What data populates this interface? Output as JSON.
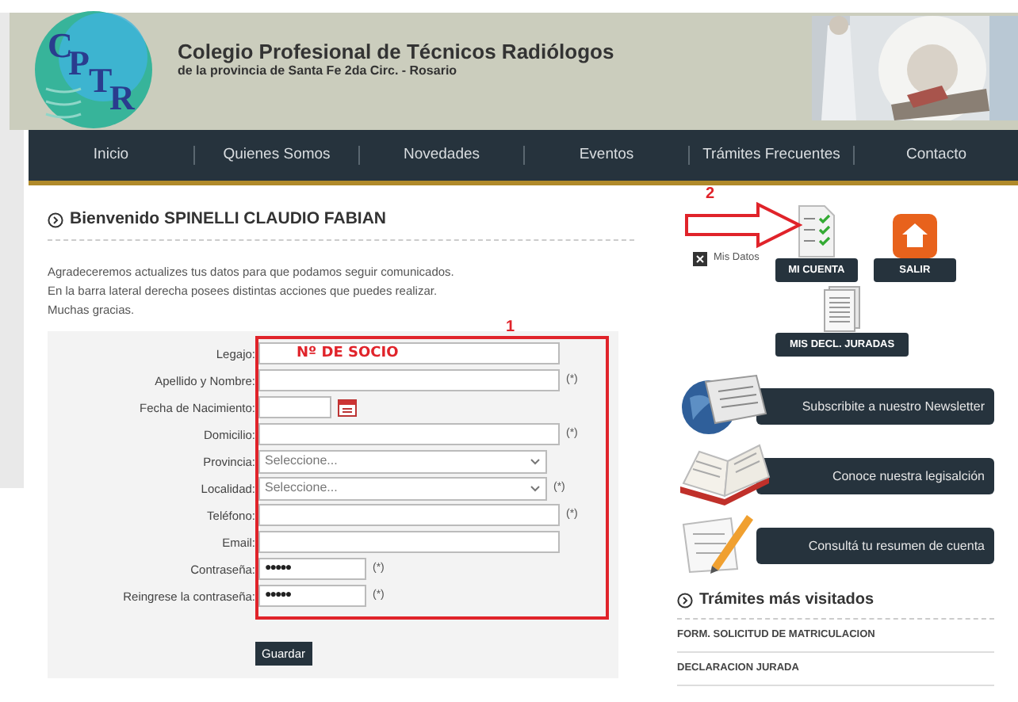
{
  "header": {
    "logo_letters": [
      "C",
      "P",
      "T",
      "R"
    ],
    "title": "Colegio  Profesional de Técnicos Radiólogos",
    "subtitle": "de la provincia de Santa Fe 2da Circ. - Rosario"
  },
  "nav": [
    {
      "label": "Inicio"
    },
    {
      "label": "Quienes Somos"
    },
    {
      "label": "Novedades"
    },
    {
      "label": "Eventos"
    },
    {
      "label": "Trámites Frecuentes"
    },
    {
      "label": "Contacto"
    }
  ],
  "welcome": {
    "title": "Bienvenido SPINELLI CLAUDIO FABIAN",
    "lines": [
      "Agradeceremos actualizes tus datos para que podamos seguir comunicados.",
      "En la barra lateral derecha posees distintas acciones que puedes realizar.",
      "Muchas gracias."
    ]
  },
  "annotations": [
    {
      "label": "1"
    },
    {
      "label": "2"
    }
  ],
  "form": {
    "fields": [
      {
        "label": "Legajo:",
        "kind": "text",
        "value": "Nº DE SOCIO",
        "required": false
      },
      {
        "label": "Apellido y Nombre:",
        "kind": "text",
        "required": true
      },
      {
        "label": "Fecha de Nacimiento:",
        "kind": "date",
        "required": false
      },
      {
        "label": "Domicilio:",
        "kind": "text",
        "required": true
      },
      {
        "label": "Provincia:",
        "kind": "select",
        "value": "Seleccione...",
        "required": false
      },
      {
        "label": "Localidad:",
        "kind": "select",
        "value": "Seleccione...",
        "required": true
      },
      {
        "label": "Teléfono:",
        "kind": "text",
        "required": true
      },
      {
        "label": "Email:",
        "kind": "text",
        "required": false
      },
      {
        "label": "Contraseña:",
        "kind": "password",
        "value": "●●●●●",
        "required": true
      },
      {
        "label": "Reingrese la contraseña:",
        "kind": "password",
        "value": "●●●●●",
        "required": true
      }
    ],
    "required_mark": "(*)",
    "submit": "Guardar"
  },
  "account": {
    "mis_datos": "Mis Datos",
    "buttons": [
      {
        "label": "MI CUENTA",
        "kind": "checklist"
      },
      {
        "label": "SALIR",
        "kind": "home"
      },
      {
        "label": "MIS DECL. JURADAS",
        "kind": "document"
      }
    ]
  },
  "banners": [
    {
      "label": "Subscribite a nuestro Newsletter",
      "kind": "news"
    },
    {
      "label": "Conoce nuestra legisalción",
      "kind": "book"
    },
    {
      "label": "Consultá tu resumen de cuenta",
      "kind": "pencil"
    }
  ],
  "tramites": {
    "title": "Trámites más visitados",
    "items": [
      "FORM. SOLICITUD DE MATRICULACION",
      "DECLARACION JURADA"
    ]
  }
}
